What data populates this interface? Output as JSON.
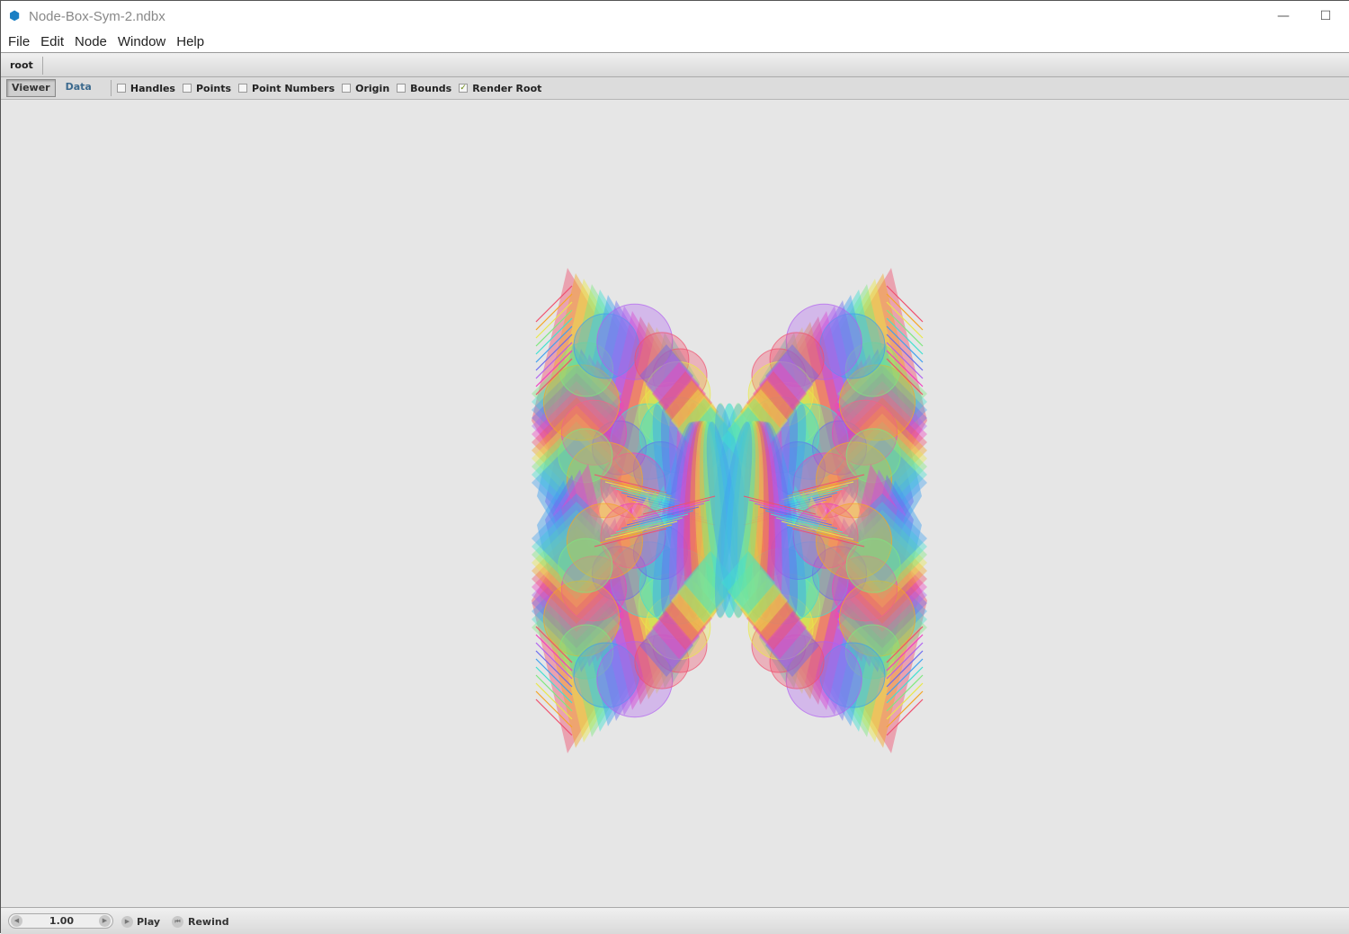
{
  "window": {
    "title": "Node-Box-Sym-2.ndbx",
    "minimize": "—",
    "maximize": "☐"
  },
  "menu": [
    "File",
    "Edit",
    "Node",
    "Window",
    "Help"
  ],
  "breadcrumb": [
    "root"
  ],
  "toolbar": {
    "tabs": [
      "Viewer",
      "Data"
    ],
    "active_tab": "Viewer",
    "checkboxes": [
      {
        "label": "Handles",
        "checked": false
      },
      {
        "label": "Points",
        "checked": false
      },
      {
        "label": "Point Numbers",
        "checked": false
      },
      {
        "label": "Origin",
        "checked": false
      },
      {
        "label": "Bounds",
        "checked": false
      },
      {
        "label": "Render Root",
        "checked": true
      }
    ]
  },
  "playback": {
    "frame": "1.00",
    "play_label": "Play",
    "rewind_label": "Rewind"
  },
  "palette": [
    "#f0506e",
    "#f5a623",
    "#e8e84a",
    "#7ee87e",
    "#40e0d0",
    "#3ea0f0",
    "#6a6af0",
    "#b060f0",
    "#f040c0"
  ]
}
